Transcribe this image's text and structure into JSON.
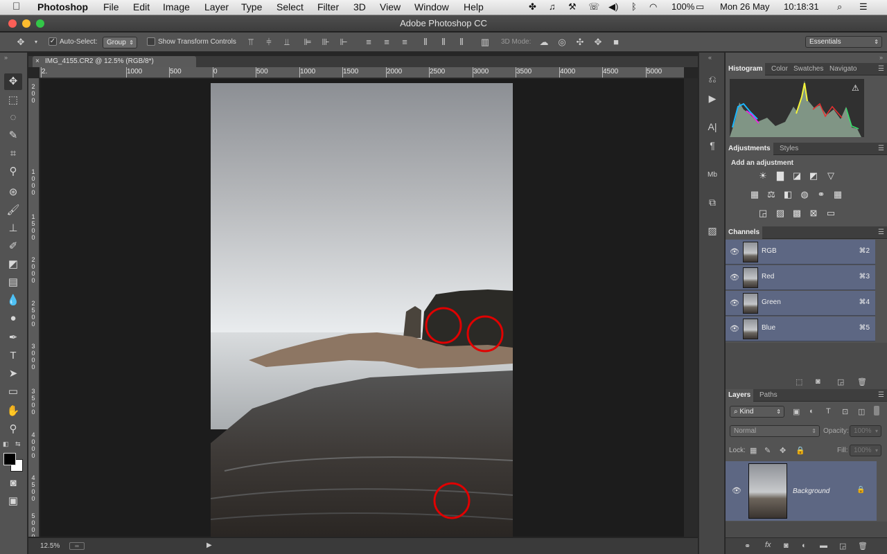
{
  "menubar": {
    "app_name": "Photoshop",
    "items": [
      "File",
      "Edit",
      "Image",
      "Layer",
      "Type",
      "Select",
      "Filter",
      "3D",
      "View",
      "Window",
      "Help"
    ],
    "battery": "100%",
    "date": "Mon 26 May",
    "time": "10:18:31"
  },
  "window": {
    "title": "Adobe Photoshop CC"
  },
  "options": {
    "auto_select_label": "Auto-Select:",
    "auto_select_value": "Group",
    "show_transform_label": "Show Transform Controls",
    "mode_3d_label": "3D Mode:",
    "workspace": "Essentials"
  },
  "document": {
    "tab_title": "IMG_4155.CR2 @ 12.5% (RGB/8*)",
    "zoom": "12.5%"
  },
  "rulers": {
    "horizontal": [
      "2.",
      "1000",
      "500",
      "0",
      "500",
      "1000",
      "1500",
      "2000",
      "2500",
      "3000",
      "3500",
      "4000",
      "4500",
      "5000"
    ],
    "vertical": [
      "2",
      "0",
      "0",
      "1",
      "0",
      "0",
      "0",
      "1",
      "5",
      "0",
      "0",
      "2",
      "0",
      "0",
      "0",
      "2",
      "5",
      "0",
      "0",
      "3",
      "0",
      "0",
      "0",
      "3",
      "5",
      "0",
      "0",
      "4",
      "0",
      "0",
      "0",
      "4",
      "5",
      "0",
      "0",
      "5",
      "0",
      "0",
      "0"
    ]
  },
  "panels": {
    "top_tabs": [
      "Histogram",
      "Color",
      "Swatches",
      "Navigato"
    ],
    "adjust_tabs": [
      "Adjustments",
      "Styles"
    ],
    "add_adjustment": "Add an adjustment",
    "channels_tab": "Channels",
    "channels": [
      {
        "name": "RGB",
        "shortcut": "⌘2"
      },
      {
        "name": "Red",
        "shortcut": "⌘3"
      },
      {
        "name": "Green",
        "shortcut": "⌘4"
      },
      {
        "name": "Blue",
        "shortcut": "⌘5"
      }
    ],
    "layer_tabs": [
      "Layers",
      "Paths"
    ],
    "kind_filter": "Kind",
    "blend_mode": "Normal",
    "opacity_label": "Opacity:",
    "opacity_value": "100%",
    "lock_label": "Lock:",
    "fill_label": "Fill:",
    "fill_value": "100%",
    "layer_name": "Background"
  },
  "colors": {
    "ui_bg": "#535353",
    "selection": "#5d6783",
    "annotation": "#e00000"
  }
}
